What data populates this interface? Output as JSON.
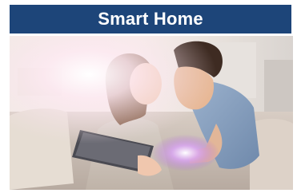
{
  "banner": {
    "title": "Smart Home",
    "background_color": "#1d4579",
    "text_color": "#ffffff"
  },
  "photo": {
    "subject": "couple-using-tablet-photo"
  }
}
